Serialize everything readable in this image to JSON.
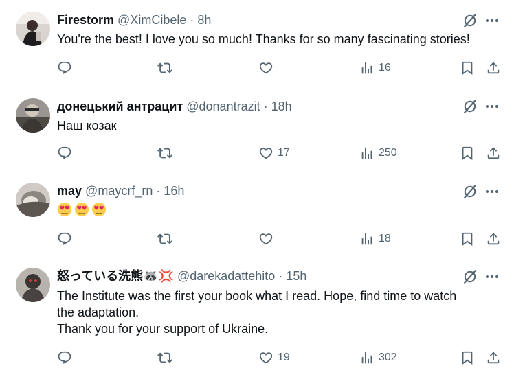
{
  "tweets": [
    {
      "name": "Firestorm",
      "handle": "@XimCibele",
      "dot": "·",
      "time": "8h",
      "lines": [
        "You're the best! I love you so much! Thanks for so many fascinating stories!"
      ],
      "emoji_count": 0,
      "replies": "",
      "retweets": "",
      "likes": "",
      "views": "16"
    },
    {
      "name": "донецький антрацит",
      "handle": "@donantrazit",
      "dot": "·",
      "time": "18h",
      "lines": [
        "Наш козак"
      ],
      "emoji_count": 0,
      "replies": "",
      "retweets": "",
      "likes": "17",
      "views": "250"
    },
    {
      "name": "may",
      "handle": "@maycrf_rn",
      "dot": "·",
      "time": "16h",
      "lines": [],
      "emoji_count": 3,
      "emoji": "smiling-face-with-heart-eyes",
      "replies": "",
      "retweets": "",
      "likes": "",
      "views": "18"
    },
    {
      "name": "怒っている洗熊🦝💢",
      "handle": "@darekadattehito",
      "dot": "·",
      "time": "15h",
      "lines": [
        "The Institute was the first your book what I read. Hope, find time to watch",
        "the adaptation.",
        "Thank you for your support of Ukraine."
      ],
      "emoji_count": 0,
      "replies": "",
      "retweets": "",
      "likes": "19",
      "views": "302"
    }
  ],
  "colors": {
    "text": "#0f1419",
    "secondary": "#536471",
    "divider": "#eff3f4"
  },
  "icons": {
    "reply": "reply-icon",
    "retweet": "retweet-icon",
    "like": "like-icon",
    "views": "views-icon",
    "bookmark": "bookmark-icon",
    "share": "share-icon",
    "grok": "grok-icon",
    "more": "more-icon"
  }
}
